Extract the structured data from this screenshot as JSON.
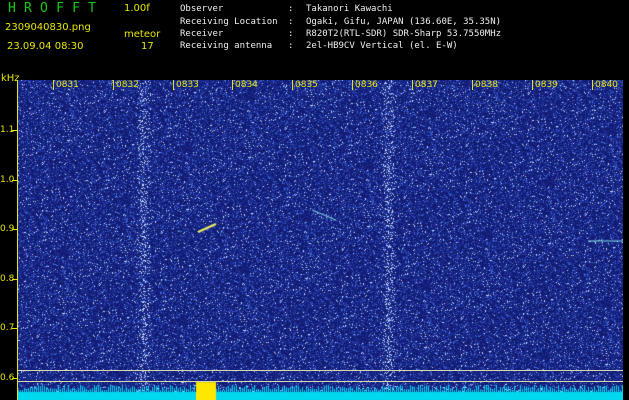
{
  "header": {
    "logo": "HROFFT",
    "version": "1.00f",
    "filename": "2309040830.png",
    "datetime": "23.09.04 08:30",
    "meteor_label": "meteor",
    "meteor_count": "17"
  },
  "info": [
    {
      "key": "Observer",
      "value": "Takanori Kawachi"
    },
    {
      "key": "Receiving Location",
      "value": "Ogaki, Gifu, JAPAN (136.60E, 35.35N)"
    },
    {
      "key": "Receiver",
      "value": "R820T2(RTL-SDR) SDR-Sharp 53.7550MHz"
    },
    {
      "key": "Receiving antenna",
      "value": "2el-HB9CV Vertical (el. E-W)"
    }
  ],
  "axis": {
    "y_unit": "kHz",
    "y_ticks": [
      "1.1",
      "1.0",
      "0.9",
      "0.8",
      "0.7",
      "0.6"
    ],
    "x_ticks": [
      "0831",
      "0832",
      "0833",
      "0834",
      "0835",
      "0836",
      "0837",
      "0838",
      "0839",
      "0840"
    ]
  },
  "colors": {
    "background": "#000000",
    "label": "#e8e800",
    "logo": "#19c919",
    "waterfall_base": "#1c2a8c",
    "signal": "#e8e800"
  }
}
